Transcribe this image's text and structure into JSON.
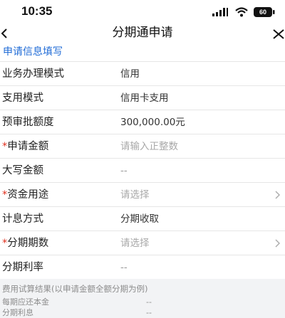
{
  "status_bar": {
    "time": "10:35",
    "battery": "60",
    "icons": [
      "signal-icon",
      "wifi-icon",
      "battery-icon"
    ]
  },
  "nav": {
    "title": "分期通申请",
    "icons": [
      "back-arrow-icon",
      "close-icon"
    ]
  },
  "section": {
    "title": "申请信息填写"
  },
  "form": {
    "rows": [
      {
        "label": "业务办理模式",
        "required": false,
        "value": "信用",
        "style": "value"
      },
      {
        "label": "支用模式",
        "required": false,
        "value": "信用卡支用",
        "style": "value"
      },
      {
        "label": "预审批额度",
        "required": false,
        "value": "300,000.00元",
        "style": "value"
      },
      {
        "label": "申请金额",
        "required": true,
        "value": "请输入正整数",
        "style": "placeholder"
      },
      {
        "label": "大写金额",
        "required": false,
        "value": "--",
        "style": "muted"
      },
      {
        "label": "资金用途",
        "required": true,
        "value": "请选择",
        "style": "placeholder",
        "chevron": true
      },
      {
        "label": "计息方式",
        "required": false,
        "value": "分期收取",
        "style": "value"
      },
      {
        "label": "分期期数",
        "required": true,
        "value": "请选择",
        "style": "placeholder",
        "chevron": true
      },
      {
        "label": "分期利率",
        "required": false,
        "value": "--",
        "style": "muted"
      }
    ]
  },
  "footer": {
    "title": "费用试算结果(以申请金额全额分期为例)",
    "lines": [
      {
        "label": "每期应还本金",
        "value": "--"
      },
      {
        "label": "分期利息",
        "value": "--"
      }
    ]
  },
  "colors": {
    "accent": "#1f6bd6",
    "required": "#e0301e",
    "background": "#f2f3f5"
  }
}
